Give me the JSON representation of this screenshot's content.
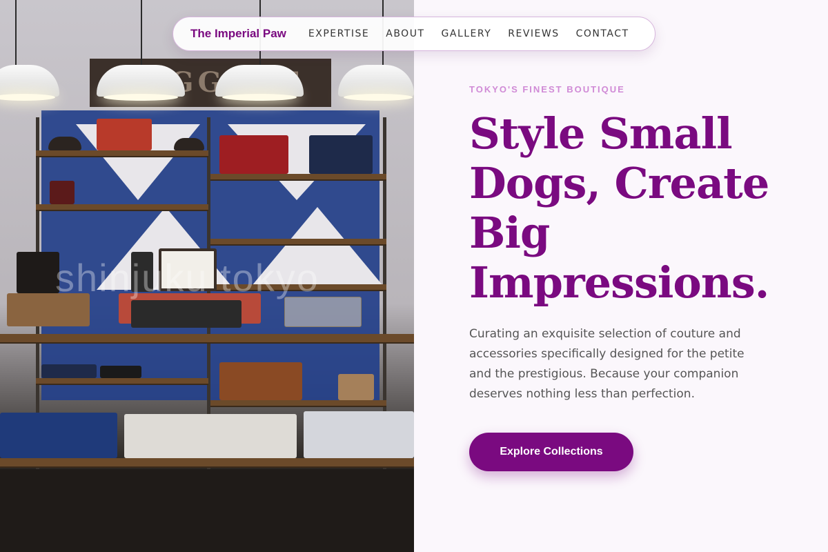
{
  "nav": {
    "brand": "The Imperial Paw",
    "links": [
      "EXPERTISE",
      "ABOUT",
      "GALLERY",
      "REVIEWS",
      "CONTACT"
    ]
  },
  "hero": {
    "eyebrow": "TOKYO'S FINEST BOUTIQUE",
    "headline": "Style Small Dogs, Create Big Impressions.",
    "lede": "Curating an exquisite selection of couture and accessories specifically designed for the petite and the prestigious. Because your companion deserves nothing less than perfection.",
    "cta_label": "Explore Collections"
  },
  "photo": {
    "sign_text": "BAGGAGE",
    "watermark": "shinjuku tokyo"
  },
  "colors": {
    "brand": "#7a0a80",
    "eyebrow": "#d08ad6",
    "body_text": "#555555",
    "page_bg": "#fbf7fc"
  }
}
